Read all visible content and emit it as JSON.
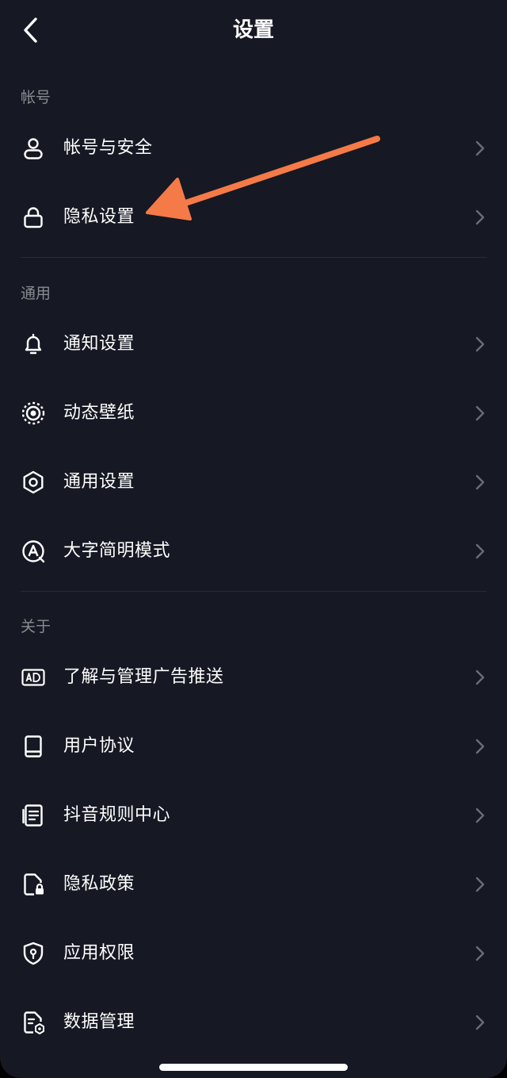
{
  "header": {
    "title": "设置"
  },
  "sections": {
    "account": {
      "title": "帐号",
      "items": [
        {
          "label": "帐号与安全",
          "icon": "user-icon"
        },
        {
          "label": "隐私设置",
          "icon": "lock-icon"
        }
      ]
    },
    "general": {
      "title": "通用",
      "items": [
        {
          "label": "通知设置",
          "icon": "bell-icon"
        },
        {
          "label": "动态壁纸",
          "icon": "live-wallpaper-icon"
        },
        {
          "label": "通用设置",
          "icon": "gear-icon"
        },
        {
          "label": "大字简明模式",
          "icon": "large-text-mode-icon"
        }
      ]
    },
    "about": {
      "title": "关于",
      "items": [
        {
          "label": "了解与管理广告推送",
          "icon": "ad-icon"
        },
        {
          "label": "用户协议",
          "icon": "book-icon"
        },
        {
          "label": "抖音规则中心",
          "icon": "rules-document-icon"
        },
        {
          "label": "隐私政策",
          "icon": "privacy-policy-icon"
        },
        {
          "label": "应用权限",
          "icon": "shield-icon"
        },
        {
          "label": "数据管理",
          "icon": "data-management-icon"
        }
      ]
    }
  },
  "colors": {
    "background": "#161823",
    "text_primary": "#ffffff",
    "text_section": "#8a8b91",
    "chevron": "#6b6c73",
    "divider": "#2a2b35",
    "annotation_arrow": "#f47a48"
  }
}
